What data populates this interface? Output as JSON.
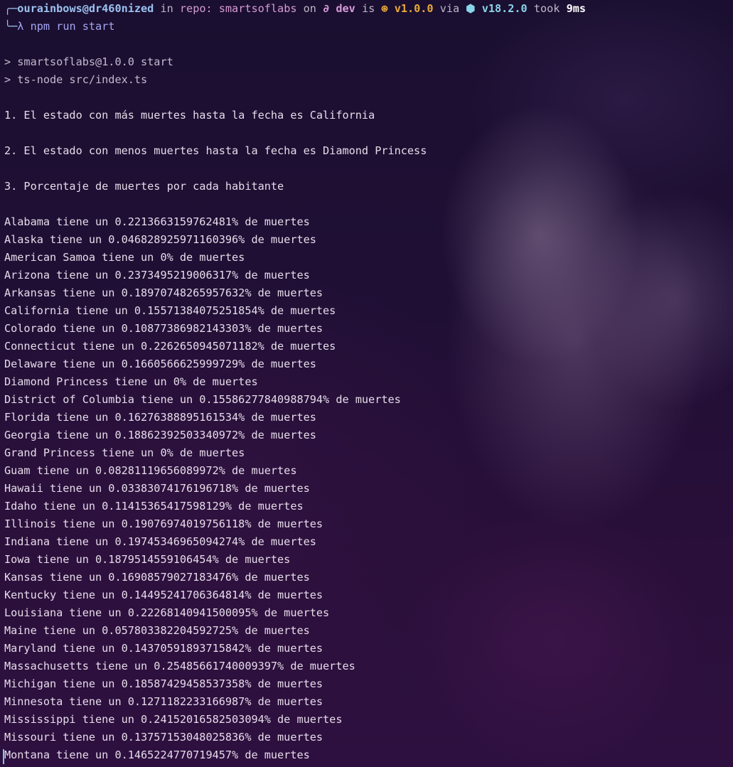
{
  "prompt": {
    "frame_top": "╭─",
    "user_host": "ourainbows@dr460nized",
    "in_word": " in ",
    "repo_label": "repo: smartsoflabs",
    "on_word": " on ",
    "branch_icon": "∂",
    "branch": " dev",
    "is_word": " is ",
    "package_icon": "⊛",
    "package_version": " v1.0.0",
    "via_word": " via ",
    "node_icon": "⬢",
    "node_version": " v18.2.0",
    "took_word": " took ",
    "duration": "9ms",
    "frame_bottom": "╰─",
    "lambda": "λ",
    "command": " npm run start"
  },
  "npm_output": [
    "> smartsoflabs@1.0.0 start",
    "> ts-node src/index.ts"
  ],
  "results": [
    "1. El estado con más muertes hasta la fecha es California",
    "2. El estado con menos muertes hasta la fecha es Diamond Princess",
    "3. Porcentaje de muertes por cada habitante"
  ],
  "percentages": [
    "Alabama tiene un 0.2213663159762481% de muertes",
    "Alaska tiene un 0.046828925971160396% de muertes",
    "American Samoa tiene un 0% de muertes",
    "Arizona tiene un 0.2373495219006317% de muertes",
    "Arkansas tiene un 0.18970748265957632% de muertes",
    "California tiene un 0.15571384075251854% de muertes",
    "Colorado tiene un 0.10877386982143303% de muertes",
    "Connecticut tiene un 0.2262650945071182% de muertes",
    "Delaware tiene un 0.1660566625999729% de muertes",
    "Diamond Princess tiene un 0% de muertes",
    "District of Columbia tiene un 0.15586277840988794% de muertes",
    "Florida tiene un 0.16276388895161534% de muertes",
    "Georgia tiene un 0.18862392503340972% de muertes",
    "Grand Princess tiene un 0% de muertes",
    "Guam tiene un 0.08281119656089972% de muertes",
    "Hawaii tiene un 0.03383074176196718% de muertes",
    "Idaho tiene un 0.11415365417598129% de muertes",
    "Illinois tiene un 0.19076974019756118% de muertes",
    "Indiana tiene un 0.19745346965094274% de muertes",
    "Iowa tiene un 0.1879514559106454% de muertes",
    "Kansas tiene un 0.16908579027183476% de muertes",
    "Kentucky tiene un 0.14495241706364814% de muertes",
    "Louisiana tiene un 0.22268140941500095% de muertes",
    "Maine tiene un 0.057803382204592725% de muertes",
    "Maryland tiene un 0.14370591893715842% de muertes",
    "Massachusetts tiene un 0.25485661740009397% de muertes",
    "Michigan tiene un 0.18587429458537358% de muertes",
    "Minnesota tiene un 0.1271182233166987% de muertes",
    "Mississippi tiene un 0.24152016582503094% de muertes",
    "Missouri tiene un 0.13757153048025836% de muertes",
    "Montana tiene un 0.1465224770719457% de muertes"
  ]
}
